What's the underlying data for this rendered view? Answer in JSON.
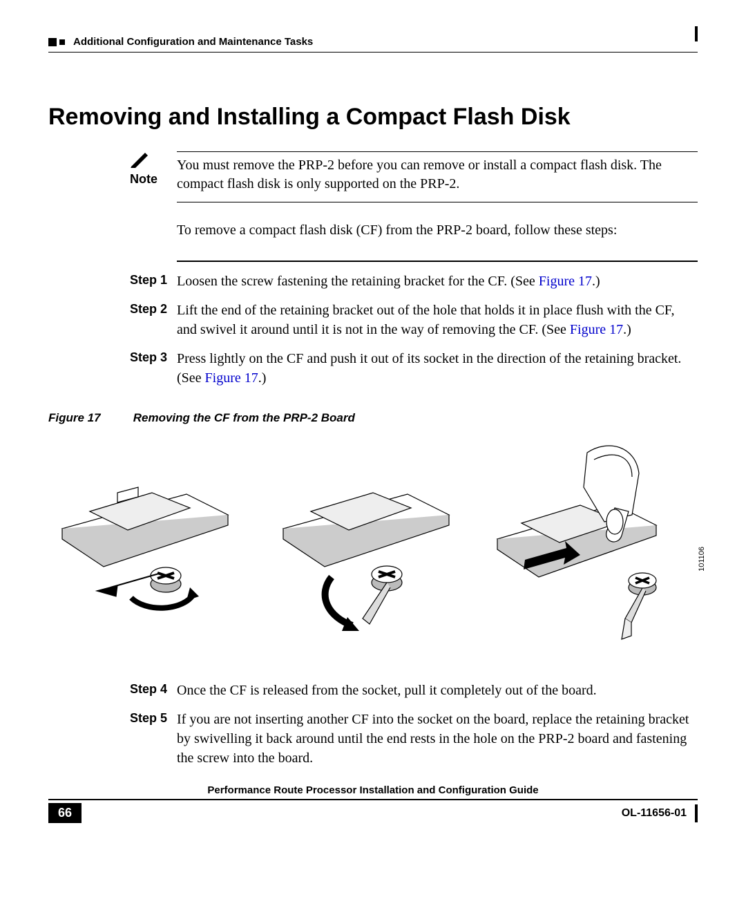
{
  "header": {
    "section_title": "Additional Configuration and Maintenance Tasks"
  },
  "title": "Removing and Installing a Compact Flash Disk",
  "note": {
    "label": "Note",
    "text": "You must remove the PRP-2 before you can remove or install a compact flash disk. The compact flash disk is only supported on the PRP-2."
  },
  "intro": "To remove a compact flash disk (CF) from the PRP-2 board, follow these steps:",
  "steps_top": [
    {
      "label": "Step 1",
      "parts": [
        {
          "t": "Loosen the screw fastening the retaining bracket for the CF. (See "
        },
        {
          "t": "Figure 17",
          "link": true
        },
        {
          "t": ".)"
        }
      ]
    },
    {
      "label": "Step 2",
      "parts": [
        {
          "t": "Lift the end of the retaining bracket out of the hole that holds it in place flush with the CF, and swivel it around until it is not in the way of removing the CF. (See "
        },
        {
          "t": "Figure 17",
          "link": true
        },
        {
          "t": ".)"
        }
      ]
    },
    {
      "label": "Step 3",
      "parts": [
        {
          "t": "Press lightly on the CF and push it out of its socket in the direction of the retaining bracket. (See "
        },
        {
          "t": "Figure 17",
          "link": true
        },
        {
          "t": ".)"
        }
      ]
    }
  ],
  "figure": {
    "label": "Figure 17",
    "caption": "Removing the CF from the PRP-2 Board",
    "id": "101106"
  },
  "steps_bottom": [
    {
      "label": "Step 4",
      "parts": [
        {
          "t": "Once the CF is released from the socket, pull it completely out of the board."
        }
      ]
    },
    {
      "label": "Step 5",
      "parts": [
        {
          "t": "If you are not inserting another CF into the socket on the board, replace the retaining bracket by swivelling it back around until the end rests in the hole on the PRP-2 board and fastening the screw into the board."
        }
      ]
    }
  ],
  "footer": {
    "guide_title": "Performance Route Processor Installation and Configuration Guide",
    "page_number": "66",
    "doc_number": "OL-11656-01"
  }
}
